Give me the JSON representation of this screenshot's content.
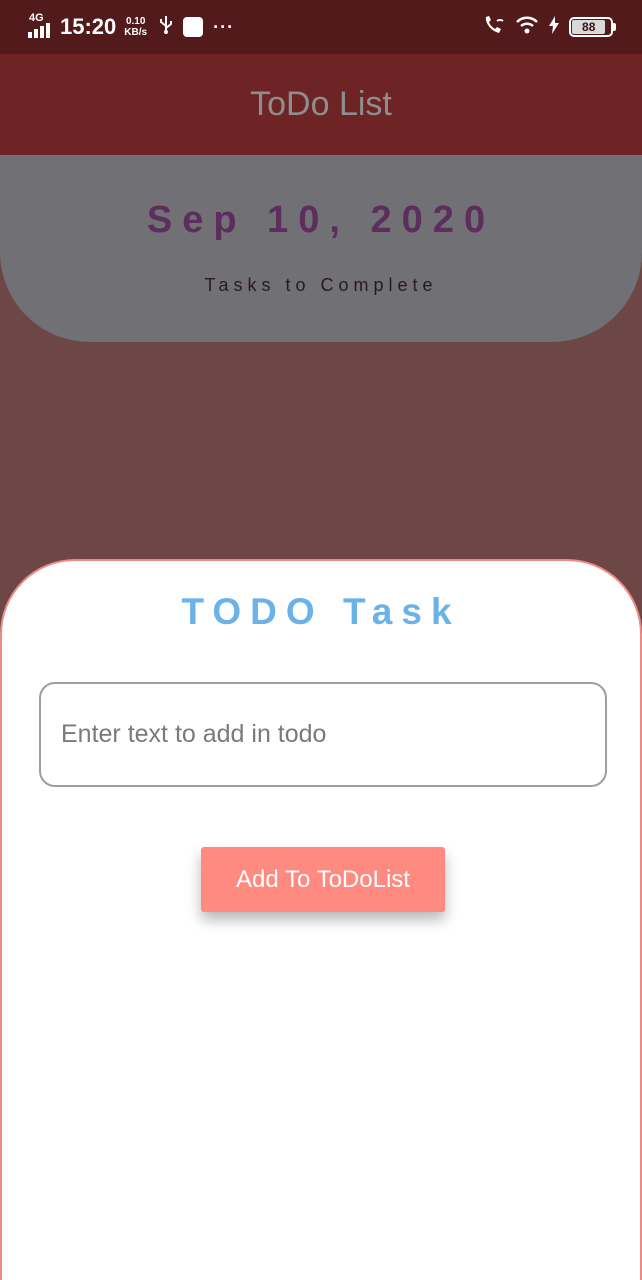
{
  "status_bar": {
    "network": "4G",
    "time": "15:20",
    "speed_value": "0.10",
    "speed_unit": "KB/s",
    "battery": "88",
    "battery_level": 88,
    "icons": [
      "signal-icon",
      "usb-icon",
      "app-notification-icon",
      "more-dots-icon",
      "wifi-call-icon",
      "wifi-icon",
      "charging-icon",
      "battery-icon"
    ]
  },
  "app_bar": {
    "title": "ToDo List"
  },
  "header": {
    "date": "Sep 10, 2020",
    "subtitle": "Tasks to Complete"
  },
  "sheet": {
    "title": "TODO Task",
    "input_placeholder": "Enter text to add in todo",
    "input_value": "",
    "button_label": "Add To ToDoList"
  },
  "colors": {
    "status_bar": "#521a1a",
    "app_bar": "#6e2424",
    "overlay_bg": "#6d4745",
    "header_card": "#717075",
    "date_text": "#5c2e5b",
    "sheet_title": "#6bb2e8",
    "button_bg": "#ff8a80",
    "sheet_border": "#ee8a84"
  }
}
